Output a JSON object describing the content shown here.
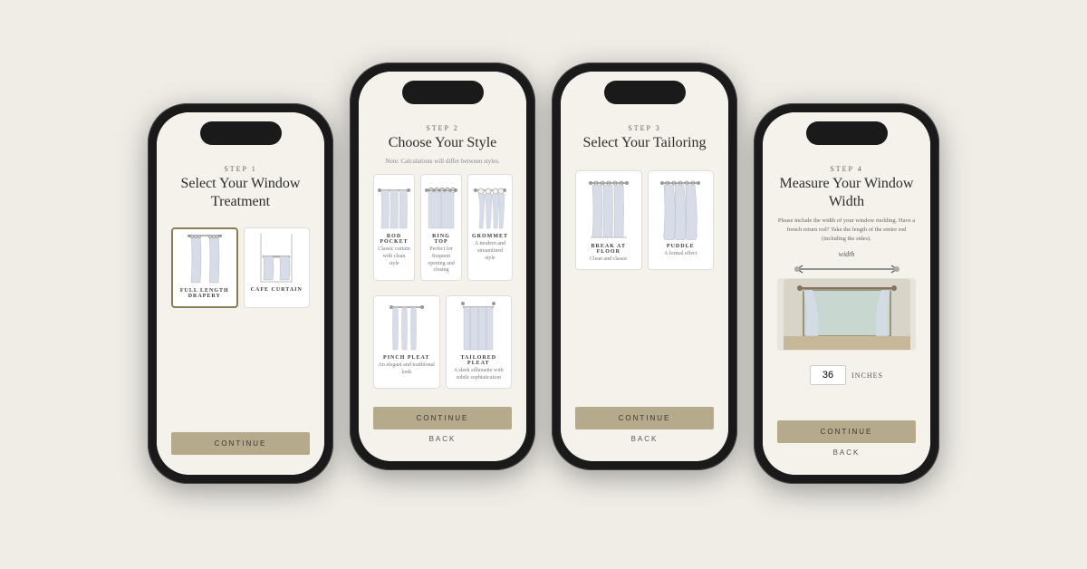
{
  "background_color": "#f0ede6",
  "phones": [
    {
      "id": "phone-1",
      "step_label": "STEP 1",
      "step_title": "Select Your Window Treatment",
      "options": [
        {
          "id": "full-length",
          "label": "FULL LENGTH DRAPERY",
          "desc": "",
          "selected": true
        },
        {
          "id": "cafe-curtain",
          "label": "CAFE CURTAIN",
          "desc": "",
          "selected": false
        }
      ],
      "continue_label": "CONTINUE",
      "back_label": null
    },
    {
      "id": "phone-2",
      "step_label": "STEP 2",
      "step_title": "Choose Your Style",
      "step_note": "Note: Calculations will differ between styles.",
      "options": [
        {
          "id": "rod-pocket",
          "label": "ROD POCKET",
          "desc": "Classic curtain with clean style",
          "selected": false
        },
        {
          "id": "ring-top",
          "label": "RING TOP",
          "desc": "Perfect for frequent opening and closing",
          "selected": false
        },
        {
          "id": "grommet",
          "label": "GROMMET",
          "desc": "A modern and streamlined style",
          "selected": false
        },
        {
          "id": "pinch-pleat",
          "label": "PINCH PLEAT",
          "desc": "An elegant and traditional look",
          "selected": false
        },
        {
          "id": "tailored-pleat",
          "label": "TAILORED PLEAT",
          "desc": "A sleek silhouette with subtle sophistication",
          "selected": false
        }
      ],
      "continue_label": "CONTINUE",
      "back_label": "BACK"
    },
    {
      "id": "phone-3",
      "step_label": "STEP 3",
      "step_title": "Select Your Tailoring",
      "options": [
        {
          "id": "break-at-floor",
          "label": "BREAK AT FLOOR",
          "desc": "Clean and classic",
          "selected": false
        },
        {
          "id": "puddle",
          "label": "PUDDLE",
          "desc": "A formal effect",
          "selected": false
        }
      ],
      "continue_label": "CONTINUE",
      "back_label": "BACK"
    },
    {
      "id": "phone-4",
      "step_label": "STEP 4",
      "step_title": "Measure Your Window Width",
      "step_desc": "Please include the width of your window molding. Have a french return rod? Take the length of the entire rod (including the sides).",
      "width_label": "width",
      "input_value": "36",
      "input_unit": "INCHES",
      "continue_label": "CONTINUE",
      "back_label": "BACK"
    }
  ]
}
